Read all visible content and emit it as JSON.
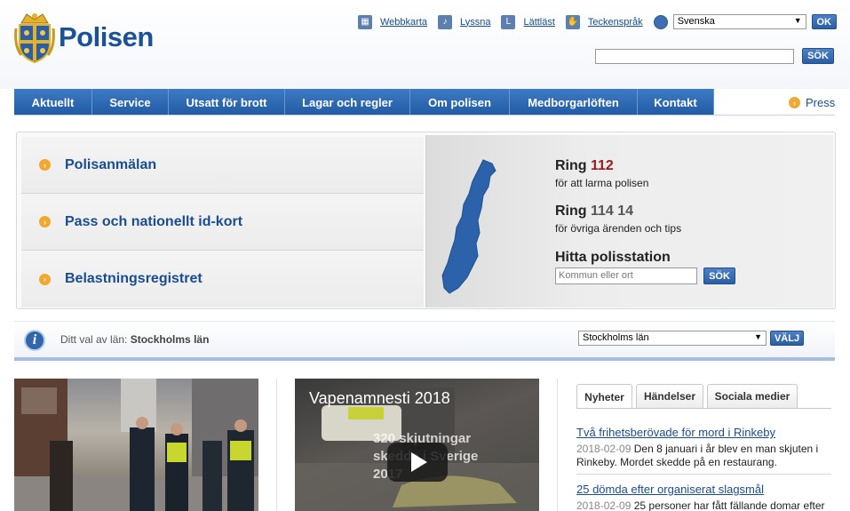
{
  "brand": {
    "name": "Polisen"
  },
  "utility": {
    "links": [
      {
        "label": "Webbkarta",
        "icon": "sitemap-icon"
      },
      {
        "label": "Lyssna",
        "icon": "listen-icon"
      },
      {
        "label": "Lättläst",
        "icon": "easy-read-icon"
      },
      {
        "label": "Teckenspråk",
        "icon": "sign-language-icon"
      }
    ],
    "language": "Svenska",
    "ok_label": "OK",
    "search_label": "SÖK"
  },
  "nav": {
    "items": [
      {
        "label": "Aktuellt"
      },
      {
        "label": "Service"
      },
      {
        "label": "Utsatt för brott"
      },
      {
        "label": "Lagar och regler"
      },
      {
        "label": "Om polisen"
      },
      {
        "label": "Medborgarlöften"
      },
      {
        "label": "Kontakt"
      }
    ],
    "press": "Press"
  },
  "quick_links": [
    {
      "label": "Polisanmälan"
    },
    {
      "label": "Pass och nationellt id-kort"
    },
    {
      "label": "Belastningsregistret"
    }
  ],
  "contact": {
    "ring_label": "Ring",
    "emergency_number": "112",
    "emergency_text": "för att larma polisen",
    "other_number": "114 14",
    "other_text": "för övriga ärenden och tips",
    "find_title": "Hitta polisstation",
    "find_placeholder": "Kommun eller ort",
    "find_button": "SÖK"
  },
  "county": {
    "prefix": "Ditt val av län:",
    "selected": "Stockholms län",
    "select_value": "Stockholms län",
    "button": "VÄLJ"
  },
  "video": {
    "title": "Vapenamnesti 2018",
    "overlay_line1": "320 skjutningar",
    "overlay_line2": "skedde i Sverige",
    "overlay_line3": "2017"
  },
  "tabs": [
    {
      "label": "Nyheter",
      "active": true
    },
    {
      "label": "Händelser",
      "active": false
    },
    {
      "label": "Sociala medier",
      "active": false
    }
  ],
  "news": [
    {
      "title": "Två frihetsberövade för mord i Rinkeby",
      "date": "2018-02-09",
      "text": "Den 8 januari i år blev en man skjuten i Rinkeby. Mordet skedde på en restaurang."
    },
    {
      "title": "25 dömda efter organiserat slagsmål",
      "date": "2018-02-09",
      "text": "25 personer har fått fällande domar efter"
    }
  ],
  "colors": {
    "brand_blue": "#1a5199",
    "nav_blue": "#2a63ad",
    "accent_orange": "#f0a92e",
    "emergency_red": "#9b1a1a"
  }
}
